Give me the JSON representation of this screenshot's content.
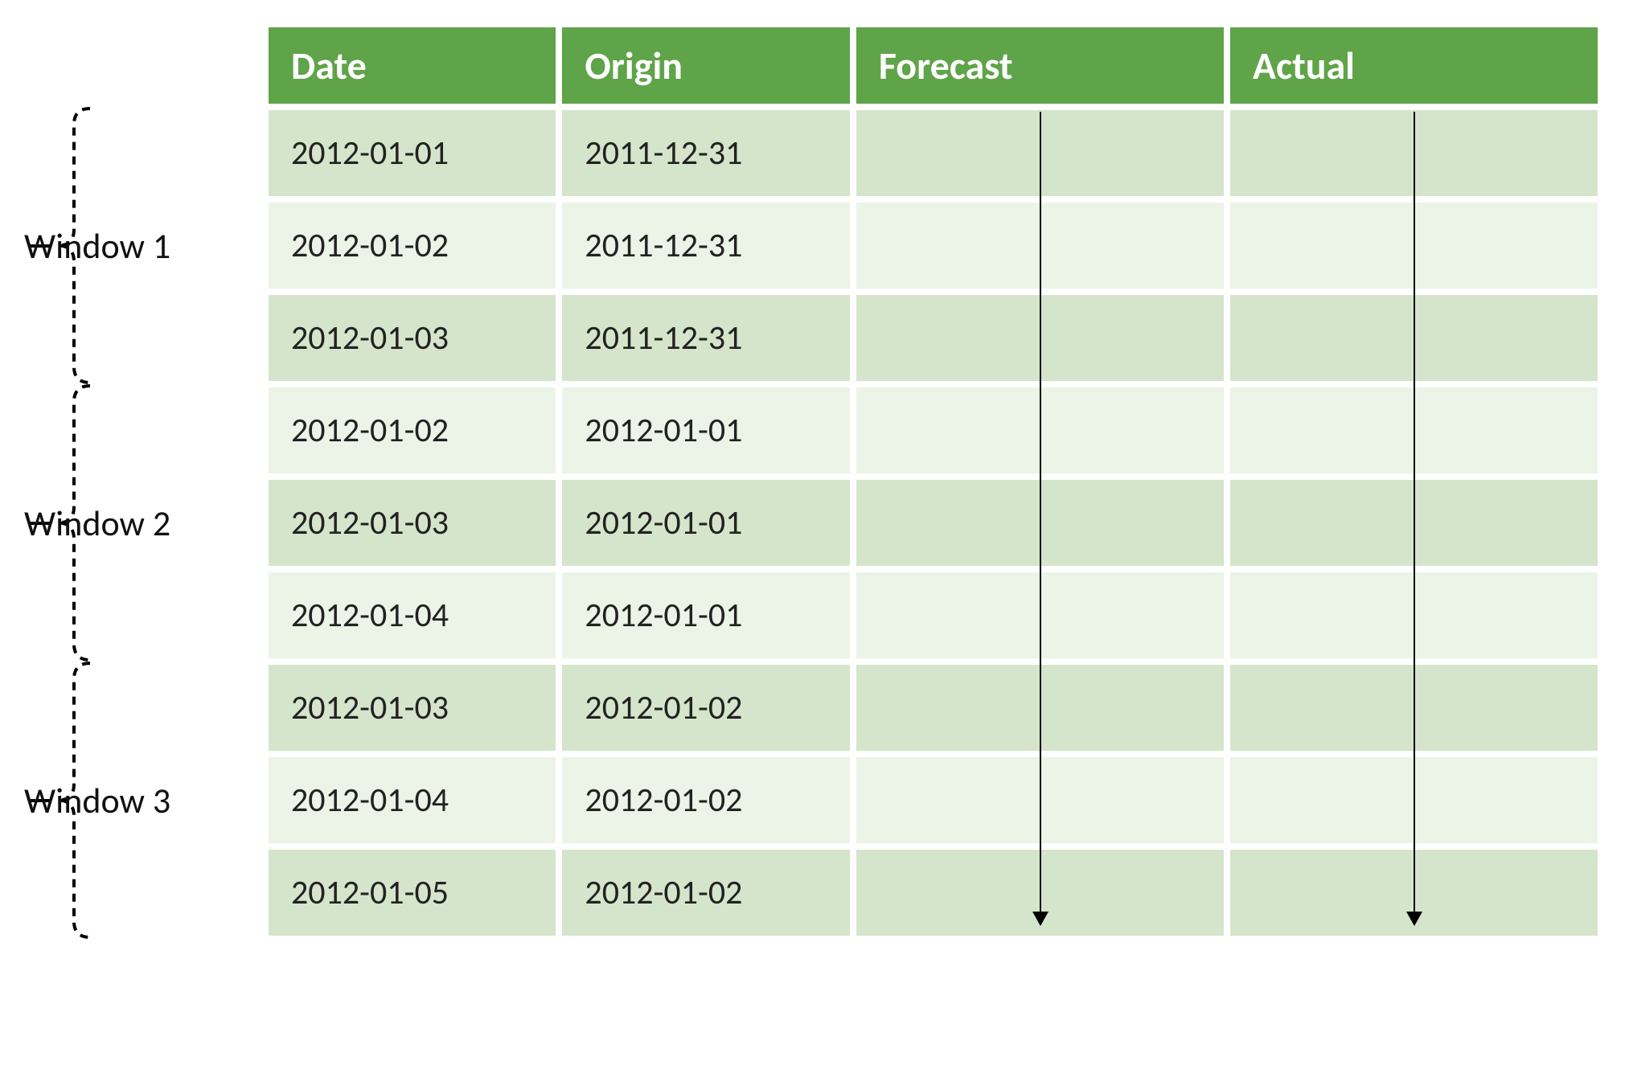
{
  "headers": {
    "date": "Date",
    "origin": "Origin",
    "forecast": "Forecast",
    "actual": "Actual"
  },
  "windows": [
    {
      "label": "Window 1"
    },
    {
      "label": "Window 2"
    },
    {
      "label": "Window 3"
    }
  ],
  "rows": [
    {
      "date": "2012-01-01",
      "origin": "2011-12-31",
      "forecast": "",
      "actual": ""
    },
    {
      "date": "2012-01-02",
      "origin": "2011-12-31",
      "forecast": "",
      "actual": ""
    },
    {
      "date": "2012-01-03",
      "origin": "2011-12-31",
      "forecast": "",
      "actual": ""
    },
    {
      "date": "2012-01-02",
      "origin": "2012-01-01",
      "forecast": "",
      "actual": ""
    },
    {
      "date": "2012-01-03",
      "origin": "2012-01-01",
      "forecast": "",
      "actual": ""
    },
    {
      "date": "2012-01-04",
      "origin": "2012-01-01",
      "forecast": "",
      "actual": ""
    },
    {
      "date": "2012-01-03",
      "origin": "2012-01-02",
      "forecast": "",
      "actual": ""
    },
    {
      "date": "2012-01-04",
      "origin": "2012-01-02",
      "forecast": "",
      "actual": ""
    },
    {
      "date": "2012-01-05",
      "origin": "2012-01-02",
      "forecast": "",
      "actual": ""
    }
  ],
  "colors": {
    "header_bg": "#5fa448",
    "row_odd": "#d5e5cb",
    "row_even": "#ecf3e7"
  }
}
